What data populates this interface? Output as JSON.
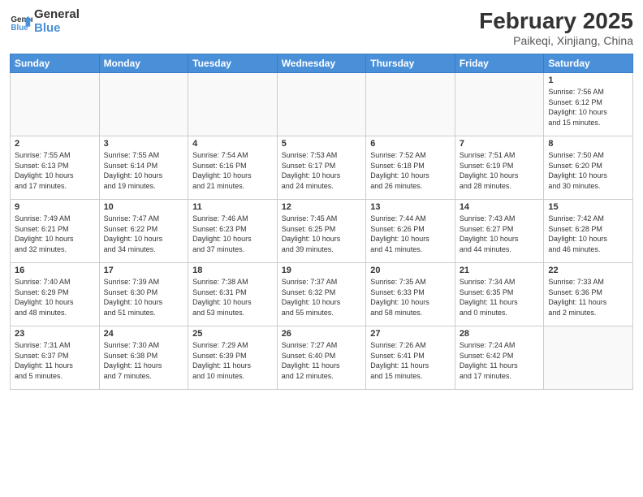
{
  "header": {
    "logo_general": "General",
    "logo_blue": "Blue",
    "month_title": "February 2025",
    "location": "Paikeqi, Xinjiang, China"
  },
  "days_of_week": [
    "Sunday",
    "Monday",
    "Tuesday",
    "Wednesday",
    "Thursday",
    "Friday",
    "Saturday"
  ],
  "weeks": [
    [
      {
        "day": "",
        "info": ""
      },
      {
        "day": "",
        "info": ""
      },
      {
        "day": "",
        "info": ""
      },
      {
        "day": "",
        "info": ""
      },
      {
        "day": "",
        "info": ""
      },
      {
        "day": "",
        "info": ""
      },
      {
        "day": "1",
        "info": "Sunrise: 7:56 AM\nSunset: 6:12 PM\nDaylight: 10 hours\nand 15 minutes."
      }
    ],
    [
      {
        "day": "2",
        "info": "Sunrise: 7:55 AM\nSunset: 6:13 PM\nDaylight: 10 hours\nand 17 minutes."
      },
      {
        "day": "3",
        "info": "Sunrise: 7:55 AM\nSunset: 6:14 PM\nDaylight: 10 hours\nand 19 minutes."
      },
      {
        "day": "4",
        "info": "Sunrise: 7:54 AM\nSunset: 6:16 PM\nDaylight: 10 hours\nand 21 minutes."
      },
      {
        "day": "5",
        "info": "Sunrise: 7:53 AM\nSunset: 6:17 PM\nDaylight: 10 hours\nand 24 minutes."
      },
      {
        "day": "6",
        "info": "Sunrise: 7:52 AM\nSunset: 6:18 PM\nDaylight: 10 hours\nand 26 minutes."
      },
      {
        "day": "7",
        "info": "Sunrise: 7:51 AM\nSunset: 6:19 PM\nDaylight: 10 hours\nand 28 minutes."
      },
      {
        "day": "8",
        "info": "Sunrise: 7:50 AM\nSunset: 6:20 PM\nDaylight: 10 hours\nand 30 minutes."
      }
    ],
    [
      {
        "day": "9",
        "info": "Sunrise: 7:49 AM\nSunset: 6:21 PM\nDaylight: 10 hours\nand 32 minutes."
      },
      {
        "day": "10",
        "info": "Sunrise: 7:47 AM\nSunset: 6:22 PM\nDaylight: 10 hours\nand 34 minutes."
      },
      {
        "day": "11",
        "info": "Sunrise: 7:46 AM\nSunset: 6:23 PM\nDaylight: 10 hours\nand 37 minutes."
      },
      {
        "day": "12",
        "info": "Sunrise: 7:45 AM\nSunset: 6:25 PM\nDaylight: 10 hours\nand 39 minutes."
      },
      {
        "day": "13",
        "info": "Sunrise: 7:44 AM\nSunset: 6:26 PM\nDaylight: 10 hours\nand 41 minutes."
      },
      {
        "day": "14",
        "info": "Sunrise: 7:43 AM\nSunset: 6:27 PM\nDaylight: 10 hours\nand 44 minutes."
      },
      {
        "day": "15",
        "info": "Sunrise: 7:42 AM\nSunset: 6:28 PM\nDaylight: 10 hours\nand 46 minutes."
      }
    ],
    [
      {
        "day": "16",
        "info": "Sunrise: 7:40 AM\nSunset: 6:29 PM\nDaylight: 10 hours\nand 48 minutes."
      },
      {
        "day": "17",
        "info": "Sunrise: 7:39 AM\nSunset: 6:30 PM\nDaylight: 10 hours\nand 51 minutes."
      },
      {
        "day": "18",
        "info": "Sunrise: 7:38 AM\nSunset: 6:31 PM\nDaylight: 10 hours\nand 53 minutes."
      },
      {
        "day": "19",
        "info": "Sunrise: 7:37 AM\nSunset: 6:32 PM\nDaylight: 10 hours\nand 55 minutes."
      },
      {
        "day": "20",
        "info": "Sunrise: 7:35 AM\nSunset: 6:33 PM\nDaylight: 10 hours\nand 58 minutes."
      },
      {
        "day": "21",
        "info": "Sunrise: 7:34 AM\nSunset: 6:35 PM\nDaylight: 11 hours\nand 0 minutes."
      },
      {
        "day": "22",
        "info": "Sunrise: 7:33 AM\nSunset: 6:36 PM\nDaylight: 11 hours\nand 2 minutes."
      }
    ],
    [
      {
        "day": "23",
        "info": "Sunrise: 7:31 AM\nSunset: 6:37 PM\nDaylight: 11 hours\nand 5 minutes."
      },
      {
        "day": "24",
        "info": "Sunrise: 7:30 AM\nSunset: 6:38 PM\nDaylight: 11 hours\nand 7 minutes."
      },
      {
        "day": "25",
        "info": "Sunrise: 7:29 AM\nSunset: 6:39 PM\nDaylight: 11 hours\nand 10 minutes."
      },
      {
        "day": "26",
        "info": "Sunrise: 7:27 AM\nSunset: 6:40 PM\nDaylight: 11 hours\nand 12 minutes."
      },
      {
        "day": "27",
        "info": "Sunrise: 7:26 AM\nSunset: 6:41 PM\nDaylight: 11 hours\nand 15 minutes."
      },
      {
        "day": "28",
        "info": "Sunrise: 7:24 AM\nSunset: 6:42 PM\nDaylight: 11 hours\nand 17 minutes."
      },
      {
        "day": "",
        "info": ""
      }
    ]
  ]
}
